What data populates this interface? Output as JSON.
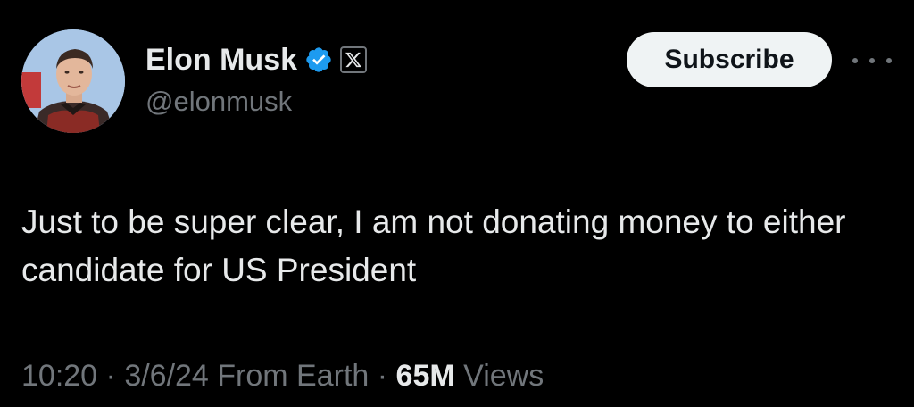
{
  "author": {
    "display_name": "Elon Musk",
    "handle": "@elonmusk",
    "verified_icon": "verified-badge-icon",
    "affiliation_icon": "x-logo-icon",
    "avatar": "profile-photo"
  },
  "actions": {
    "subscribe_label": "Subscribe",
    "more_icon": "more-options-icon"
  },
  "tweet": {
    "text": "Just to be super clear, I am not donating money to either candidate for US President"
  },
  "meta": {
    "time": "10:20",
    "sep1": " · ",
    "date": "3/6/24",
    "source": " From Earth",
    "sep2": " · ",
    "views_count": "65M",
    "views_label": " Views"
  },
  "colors": {
    "background": "#000000",
    "text_primary": "#e7e9ea",
    "text_secondary": "#71767b",
    "verified_blue": "#1d9bf0",
    "button_bg": "#eff3f4"
  }
}
